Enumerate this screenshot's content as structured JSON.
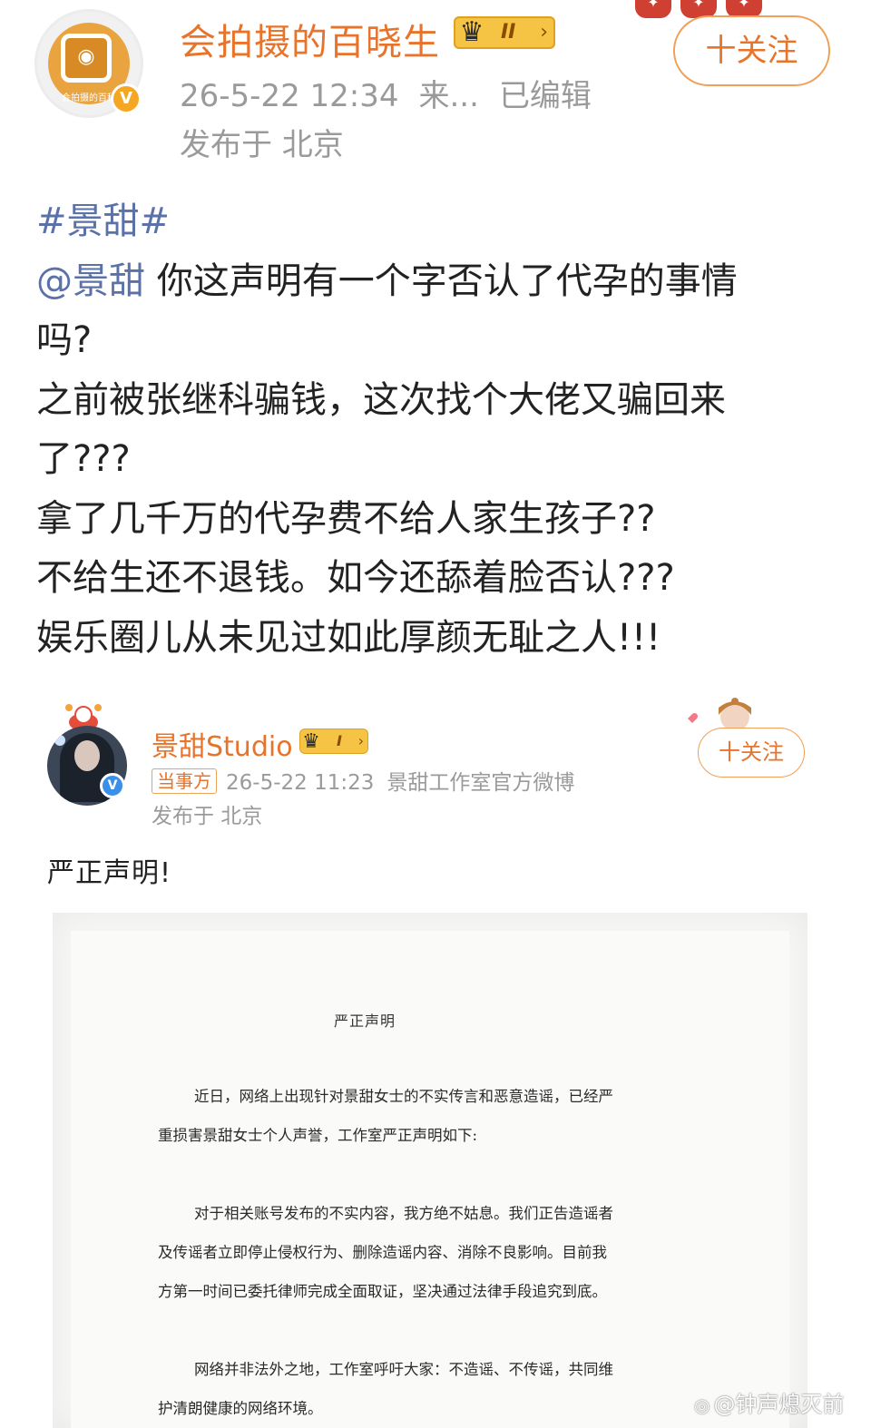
{
  "post": {
    "author": "会拍摄的百晓生",
    "avatar_caption": "会拍摄的百科",
    "level": "II",
    "meta": {
      "time": "26-5-22 12:34",
      "source": "来...",
      "edited": "已编辑"
    },
    "location": "发布于 北京",
    "follow_label": "十关注",
    "content": {
      "topic": "#景甜#",
      "mention": "@景甜",
      "lines": [
        "你这声明有一个字否认了代孕的事情",
        "吗?",
        "之前被张继科骗钱，这次找个大佬又骗回来",
        "了???",
        "拿了几千万的代孕费不给人家生孩子??",
        "不给生还不退钱。如今还舔着脸否认???",
        "娱乐圈儿从未见过如此厚颜无耻之人!!!"
      ]
    }
  },
  "repost": {
    "author": "景甜Studio",
    "level": "I",
    "party_tag": "当事方",
    "time": "26-5-22 11:23",
    "source": "景甜工作室官方微博",
    "location": "发布于 北京",
    "follow_label": "十关注",
    "text": "严正声明!",
    "statement_image": {
      "title": "严正声明",
      "paragraphs": [
        [
          "近日，网络上出现针对景甜女士的不实传言和恶意造谣，已经严",
          "重损害景甜女士个人声誉，工作室严正声明如下:"
        ],
        [
          "对于相关账号发布的不实内容，我方绝不姑息。我们正告造谣者",
          "及传谣者立即停止侵权行为、删除造谣内容、消除不良影响。目前我",
          "方第一时间已委托律师完成全面取证，坚决通过法律手段追究到底。"
        ],
        [
          "网络并非法外之地，工作室呼吁大家：不造谣、不传谣，共同维",
          "护清朗健康的网络环境。"
        ]
      ]
    }
  },
  "watermark": "@钟声熄灭前",
  "colors": {
    "author_orange": "#e8732a",
    "link_blue": "#5a72a8",
    "meta_gray": "#9a9a9a",
    "badge_gold": "#f6c445",
    "verified_blue": "#3a8fe8"
  },
  "icons": [
    "crown-icon",
    "verified-icon",
    "weibo-icon"
  ]
}
